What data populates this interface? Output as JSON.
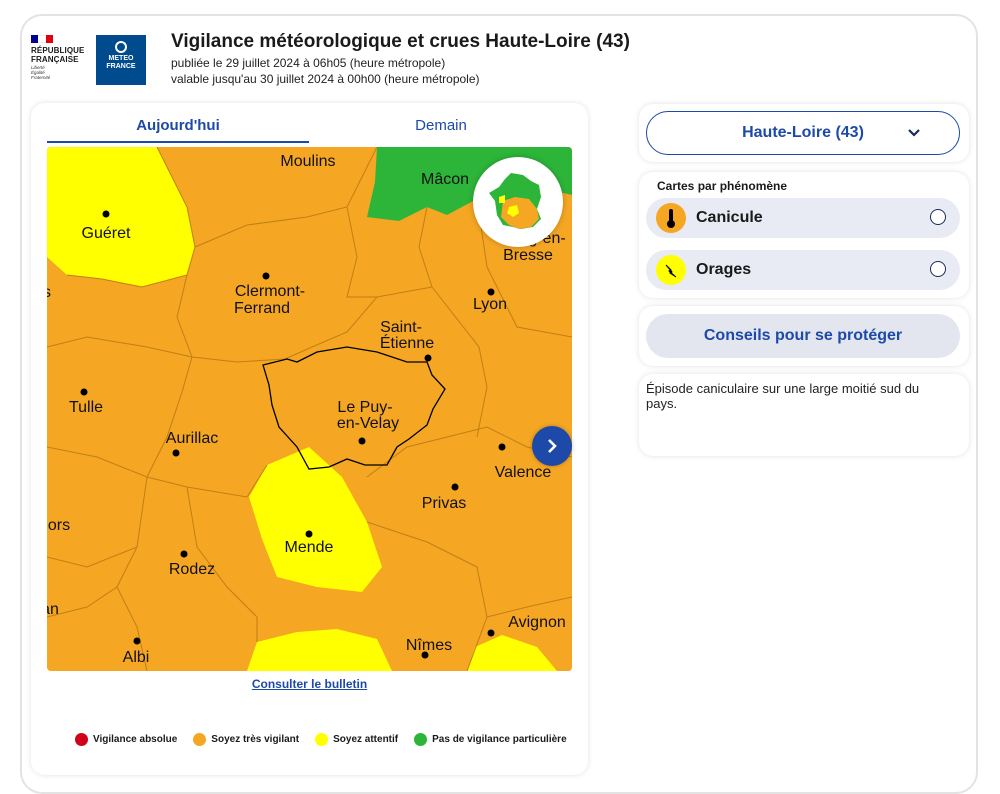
{
  "header": {
    "rf": {
      "line1": "RÉPUBLIQUE",
      "line2": "FRANÇAISE",
      "motto1": "Liberté",
      "motto2": "Égalité",
      "motto3": "Fraternité"
    },
    "mf": {
      "line1": "METEO",
      "line2": "FRANCE"
    },
    "title": "Vigilance météorologique et crues Haute-Loire (43)",
    "published": "publiée le 29 juillet 2024 à 06h05 (heure métropole)",
    "valid_until": "valable jusqu'au 30 juillet 2024 à 00h00 (heure métropole)"
  },
  "tabs": {
    "today": "Aujourd'hui",
    "tomorrow": "Demain"
  },
  "map": {
    "cities": {
      "moulins": "Moulins",
      "macon": "Mâcon",
      "gueret": "Guéret",
      "bourg1": "g-en-",
      "bourg2": "Bresse",
      "clermont1": "Clermont-",
      "clermont2": "Ferrand",
      "lyon": "Lyon",
      "stetienne1": "Saint-",
      "stetienne2": "Étienne",
      "tulle": "Tulle",
      "lepuy1": "Le Puy-",
      "lepuy2": "en-Velay",
      "aurillac": "Aurillac",
      "valence": "Valence",
      "privas": "Privas",
      "ors": "ors",
      "mende": "Mende",
      "rodez": "Rodez",
      "an": "an",
      "avignon": "Avignon",
      "albi": "Albi",
      "nimes": "Nîmes",
      "s": "s"
    },
    "colors": {
      "orange": "#f5a623",
      "yellow": "#ffff00",
      "green": "#2db53a",
      "red": "#d0021b"
    }
  },
  "bulletin_link": "Consulter le bulletin",
  "legend": [
    {
      "label": "Vigilance absolue",
      "color": "#d0021b"
    },
    {
      "label": "Soyez très vigilant",
      "color": "#f5a623"
    },
    {
      "label": "Soyez attentif",
      "color": "#ffff00"
    },
    {
      "label": "Pas de vigilance particulière",
      "color": "#2db53a"
    }
  ],
  "sidebar": {
    "department": "Haute-Loire (43)",
    "phenomena_title": "Cartes par phénomène",
    "phenomena": [
      {
        "label": "Canicule",
        "icon": "thermometer-icon",
        "color": "#f5a623"
      },
      {
        "label": "Orages",
        "icon": "lightning-icon",
        "color": "#ffff00"
      }
    ],
    "advice_button": "Conseils pour se protéger",
    "note": "Épisode caniculaire sur une large moitié sud du pays."
  }
}
